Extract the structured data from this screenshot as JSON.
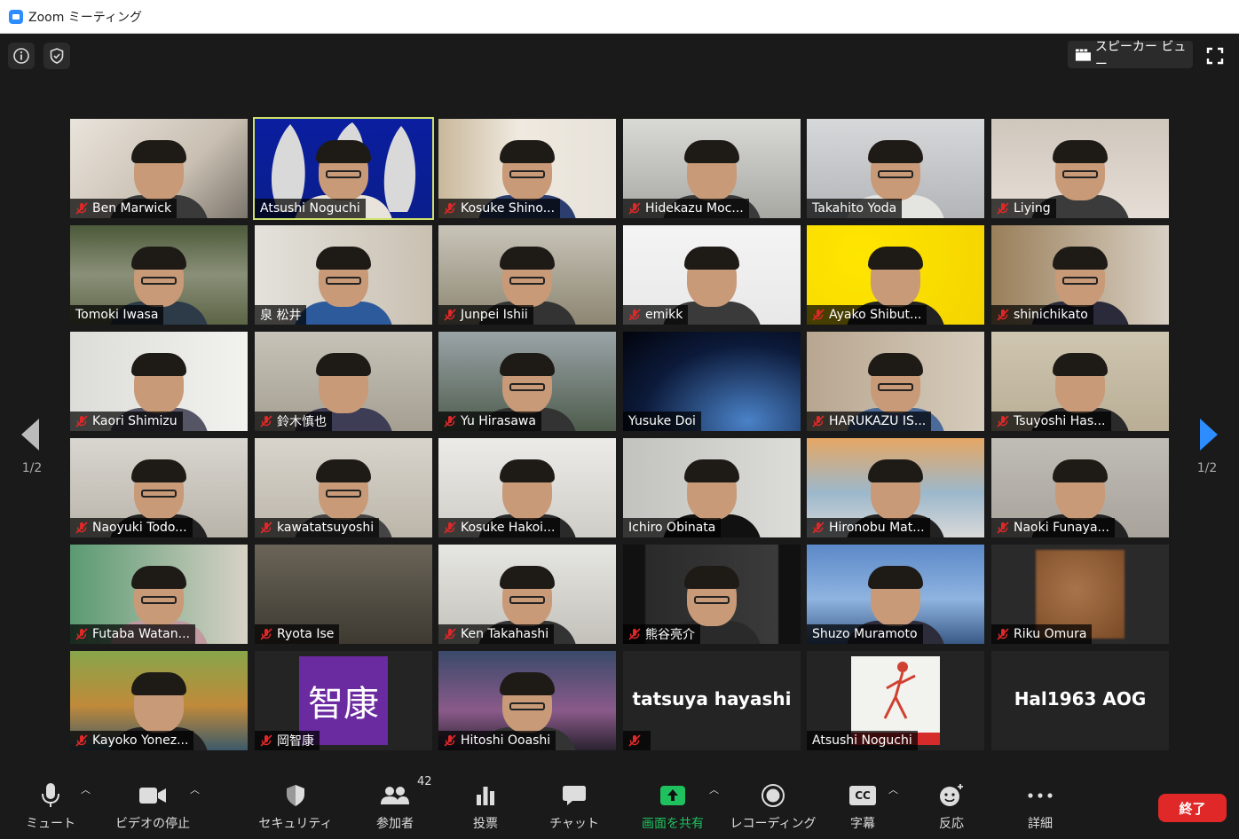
{
  "window": {
    "title": "Zoom ミーティング"
  },
  "top": {
    "speaker_view_label": "スピーカー ビュー"
  },
  "pagination": {
    "left": "1/2",
    "right": "1/2"
  },
  "participants": [
    {
      "name": "Ben Marwick",
      "muted": true
    },
    {
      "name": "Atsushi Noguchi",
      "muted": false
    },
    {
      "name": "Kosuke Shino...",
      "muted": true
    },
    {
      "name": "Hidekazu Moc...",
      "muted": true
    },
    {
      "name": "Takahito Yoda",
      "muted": false
    },
    {
      "name": "Liying",
      "muted": true
    },
    {
      "name": "Tomoki Iwasa",
      "muted": false
    },
    {
      "name": "泉 松井",
      "muted": false
    },
    {
      "name": "Junpei Ishii",
      "muted": true
    },
    {
      "name": "emikk",
      "muted": true
    },
    {
      "name": "Ayako Shibut...",
      "muted": true
    },
    {
      "name": "shinichikato",
      "muted": true
    },
    {
      "name": "Kaori Shimizu",
      "muted": true
    },
    {
      "name": "鈴木慎也",
      "muted": true
    },
    {
      "name": "Yu Hirasawa",
      "muted": true
    },
    {
      "name": "Yusuke Doi",
      "muted": false
    },
    {
      "name": "HARUKAZU IS...",
      "muted": true
    },
    {
      "name": "Tsuyoshi Has...",
      "muted": true
    },
    {
      "name": "Naoyuki Todo...",
      "muted": true
    },
    {
      "name": "kawatatsuyoshi",
      "muted": true
    },
    {
      "name": "Kosuke Hakoi...",
      "muted": true
    },
    {
      "name": "Ichiro Obinata",
      "muted": false
    },
    {
      "name": "Hironobu Mat...",
      "muted": true
    },
    {
      "name": "Naoki Funaya...",
      "muted": true
    },
    {
      "name": "Futaba Watan...",
      "muted": true
    },
    {
      "name": "Ryota Ise",
      "muted": true
    },
    {
      "name": "Ken Takahashi",
      "muted": true
    },
    {
      "name": "熊谷亮介",
      "muted": true
    },
    {
      "name": "Shuzo Muramoto",
      "muted": false
    },
    {
      "name": "Riku Omura",
      "muted": true
    },
    {
      "name": "Kayoko Yonez...",
      "muted": true
    },
    {
      "name": "岡智康",
      "muted": true
    },
    {
      "name": "Hitoshi Ooashi",
      "muted": true
    },
    {
      "name": "",
      "muted": true
    },
    {
      "name": "Atsushi Noguchi",
      "muted": false
    },
    {
      "name": "",
      "muted": false
    }
  ],
  "tile_text": {
    "avatar_kanji": "智康",
    "tatsuya": "tatsuya hayashi",
    "hal": "Hal1963 AOG"
  },
  "toolbar": {
    "mute": "ミュート",
    "video": "ビデオの停止",
    "security": "セキュリティ",
    "participants": "参加者",
    "participants_count": "42",
    "polls": "投票",
    "chat": "チャット",
    "share": "画面を共有",
    "record": "レコーディング",
    "cc_icon_text": "CC",
    "captions": "字幕",
    "reactions": "反応",
    "more": "詳細",
    "end": "終了"
  },
  "colors": {
    "accent_green": "#1fc15f",
    "end_red": "#e02828",
    "active_border": "#cfe06a",
    "mute_red": "#e02828"
  }
}
